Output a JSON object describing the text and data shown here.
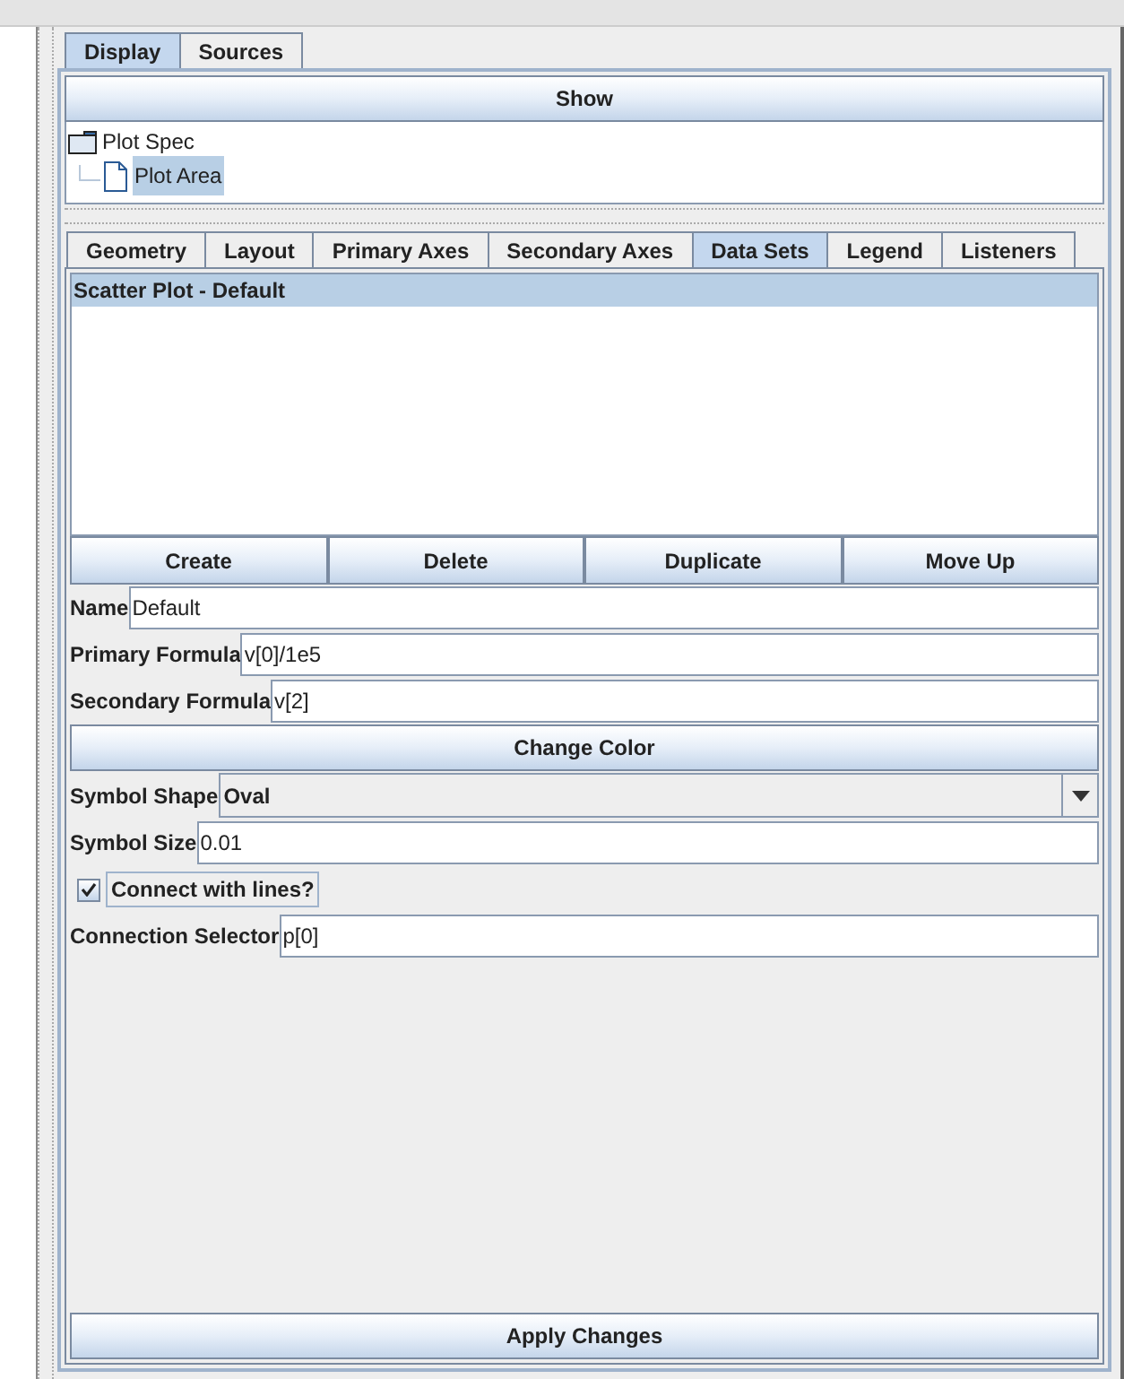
{
  "top_tabs": [
    {
      "label": "Display",
      "selected": true
    },
    {
      "label": "Sources",
      "selected": false
    }
  ],
  "show_button": "Show",
  "tree": {
    "label": "Plot Spec",
    "selected": false,
    "children": [
      {
        "label": "Plot Area",
        "selected": true
      }
    ]
  },
  "tabs": [
    {
      "label": "Geometry",
      "selected": false
    },
    {
      "label": "Layout",
      "selected": false
    },
    {
      "label": "Primary Axes",
      "selected": false
    },
    {
      "label": "Secondary Axes",
      "selected": false
    },
    {
      "label": "Data Sets",
      "selected": true
    },
    {
      "label": "Legend",
      "selected": false
    },
    {
      "label": "Listeners",
      "selected": false
    }
  ],
  "data_sets": [
    {
      "label": "Scatter Plot - Default",
      "selected": true
    }
  ],
  "actions": [
    "Create",
    "Delete",
    "Duplicate",
    "Move Up"
  ],
  "fields": [
    {
      "kind": "text",
      "label": "Name",
      "value": "Default"
    },
    {
      "kind": "text",
      "label": "Primary Formula",
      "value": "v[0]/1e5"
    },
    {
      "kind": "text",
      "label": "Secondary Formula",
      "value": "v[2]"
    },
    {
      "kind": "button",
      "label": "Change Color"
    },
    {
      "kind": "combo",
      "label": "Symbol Shape",
      "value": "Oval"
    },
    {
      "kind": "text",
      "label": "Symbol Size",
      "value": "0.01"
    },
    {
      "kind": "checkbox",
      "label": "Connect with lines?",
      "checked": true
    },
    {
      "kind": "text",
      "label": "Connection Selector",
      "value": "p[0]"
    }
  ],
  "apply_button": "Apply Changes"
}
